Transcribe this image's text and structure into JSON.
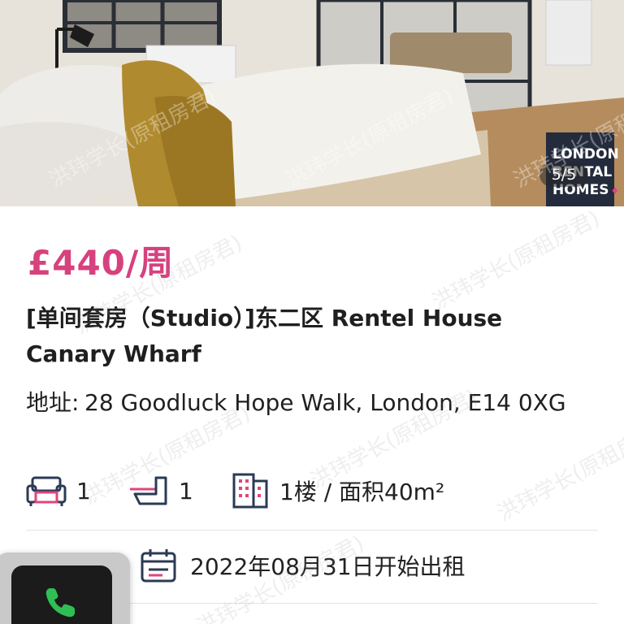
{
  "photo": {
    "counter": "5/5",
    "brand_badge": {
      "line1": "LONDON",
      "line2": "RENTAL",
      "line3": "HOMES"
    }
  },
  "listing": {
    "price": "£440/周",
    "title": "[单间套房（Studio）]东二区 Rentel House Canary Wharf",
    "address_label": "地址:",
    "address_value": "28 Goodluck Hope Walk, London, E14 0XG",
    "features": {
      "living_rooms": "1",
      "bathrooms": "1",
      "floor_area": "1楼 / 面积40m²"
    },
    "available_from": "2022年08月31日开始出租"
  },
  "watermark": {
    "text": "洪玮学长(原租房君)"
  },
  "colors": {
    "price_pink": "#d6417e",
    "icon_navy": "#2b3a55",
    "icon_pink": "#e0457b",
    "call_green": "#2fbf55"
  },
  "icons": {
    "sofa": "sofa-icon",
    "bath": "bathtub-icon",
    "building": "building-icon",
    "calendar": "calendar-icon",
    "phone": "phone-icon"
  }
}
